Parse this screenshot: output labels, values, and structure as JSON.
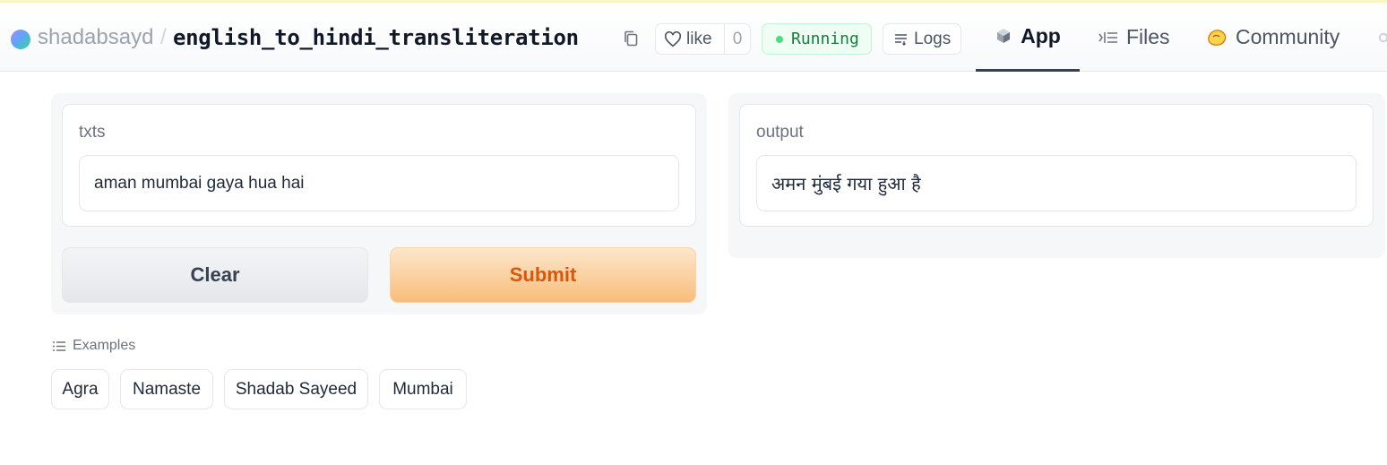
{
  "header": {
    "owner": "shadabsayd",
    "separator": "/",
    "repo": "english_to_hindi_transliteration",
    "like_label": "like",
    "like_count": "0",
    "status": "Running",
    "logs_label": "Logs",
    "tabs": [
      {
        "label": "App",
        "icon": "cube-icon",
        "active": true
      },
      {
        "label": "Files",
        "icon": "files-icon",
        "active": false
      },
      {
        "label": "Community",
        "icon": "hands-icon",
        "active": false
      }
    ]
  },
  "input": {
    "label": "txts",
    "value": "aman mumbai gaya hua hai"
  },
  "output": {
    "label": "output",
    "value": "अमन मुंबई गया हुआ है"
  },
  "buttons": {
    "clear": "Clear",
    "submit": "Submit"
  },
  "examples": {
    "label": "Examples",
    "items": [
      "Agra",
      "Namaste",
      "Shadab Sayeed",
      "Mumbai"
    ]
  },
  "colors": {
    "accent": "#d9560b",
    "running_green": "#15803d",
    "running_bg": "#f0fdf4"
  }
}
